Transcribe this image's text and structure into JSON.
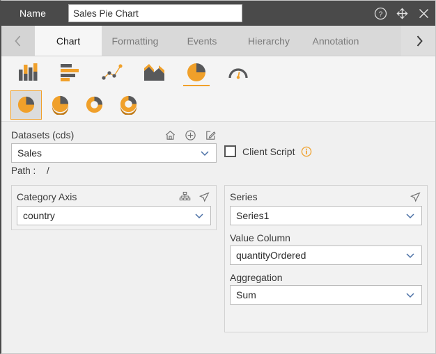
{
  "window": {
    "name_label": "Name",
    "name_value": "Sales Pie Chart",
    "name_placeholder": "",
    "controls": {
      "help": "help-circle-icon",
      "move": "move-arrows-icon",
      "close": "close-x-icon"
    }
  },
  "tabs": {
    "prev_arrow": "‹",
    "next_arrow": "›",
    "items": [
      {
        "label": "Chart",
        "active": true
      },
      {
        "label": "Formatting",
        "active": false
      },
      {
        "label": "Events",
        "active": false
      },
      {
        "label": "Hierarchy",
        "active": false
      },
      {
        "label": "Annotation",
        "active": false
      }
    ]
  },
  "chart_types": [
    {
      "name": "column-chart-icon",
      "selected": false
    },
    {
      "name": "bar-chart-icon",
      "selected": false
    },
    {
      "name": "scatter-line-chart-icon",
      "selected": false
    },
    {
      "name": "area-chart-icon",
      "selected": false
    },
    {
      "name": "pie-chart-icon",
      "selected": true
    },
    {
      "name": "gauge-chart-icon",
      "selected": false
    }
  ],
  "chart_subtypes": [
    {
      "name": "pie-flat-icon",
      "selected": true
    },
    {
      "name": "pie-3d-icon",
      "selected": false
    },
    {
      "name": "donut-flat-icon",
      "selected": false
    },
    {
      "name": "donut-3d-icon",
      "selected": false
    }
  ],
  "datasets": {
    "label": "Datasets (cds)",
    "value": "Sales",
    "icons": [
      "home-icon",
      "add-circle-icon",
      "edit-pencil-icon"
    ],
    "path_label": "Path :",
    "path_value": "/"
  },
  "client_script": {
    "label": "Client Script",
    "checked": false,
    "info_icon": "info-circle-icon"
  },
  "category_axis": {
    "title": "Category Axis",
    "icons": [
      "hierarchy-tree-icon",
      "send-arrow-icon"
    ],
    "value": "country"
  },
  "series": {
    "title": "Series",
    "icons": [
      "send-arrow-icon"
    ],
    "value": "Series1",
    "value_column_label": "Value Column",
    "value_column": "quantityOrdered",
    "aggregation_label": "Aggregation",
    "aggregation": "Sum"
  },
  "colors": {
    "accent": "#f0a02a",
    "titlebar": "#4a4a4a",
    "tabbar": "#d9d9d9",
    "panel_bg": "#f2f2f2",
    "dark_gray": "#58595b"
  }
}
